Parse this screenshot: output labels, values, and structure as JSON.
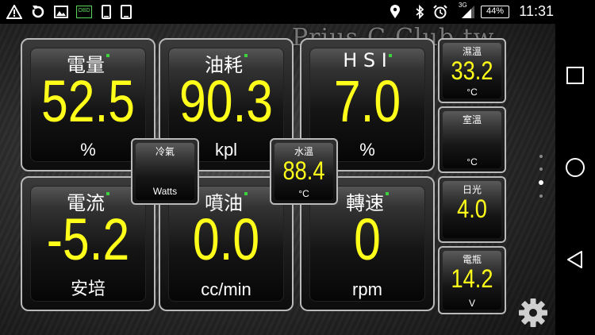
{
  "status_bar": {
    "left_icons": [
      "warning-icon",
      "sync-icon",
      "image-icon",
      "obd-icon",
      "phone-icon",
      "tablet-icon"
    ],
    "obd_label": "OBD",
    "right_icons": [
      "location-icon",
      "bluetooth-icon",
      "alarm-icon",
      "signal-icon"
    ],
    "network": "3G",
    "battery": "44%",
    "time": "11:31"
  },
  "watermark": "Prius-C-Club.tw",
  "gauges": {
    "battery_level": {
      "title": "電量",
      "value": "52.5",
      "unit": "%"
    },
    "fuel_economy": {
      "title": "油耗",
      "value": "90.3",
      "unit": "kpl"
    },
    "hsi": {
      "title": "H S I",
      "value": "7.0",
      "unit": "%"
    },
    "current": {
      "title": "電流",
      "value": "-5.2",
      "unit": "安培"
    },
    "injection": {
      "title": "噴油",
      "value": "0.0",
      "unit": "cc/min"
    },
    "rpm": {
      "title": "轉速",
      "value": "0",
      "unit": "rpm"
    }
  },
  "small_gauges": {
    "ac": {
      "title": "冷氣",
      "value": "",
      "unit": "Watts"
    },
    "water_temp": {
      "title": "水溫",
      "value": "88.4",
      "unit": "°C"
    },
    "ambient_temp": {
      "title": "濕溫",
      "value": "33.2",
      "unit": "°C"
    },
    "cabin_temp": {
      "title": "室溫",
      "value": "",
      "unit": "°C"
    },
    "sunlight": {
      "title": "日光",
      "value": "4.0",
      "unit": ""
    },
    "battery_voltage": {
      "title": "電瓶",
      "value": "14.2",
      "unit": "V"
    }
  },
  "colors": {
    "value": "#ffff1a",
    "indicator": "#3cd23c",
    "frame": "#b9b9b9"
  },
  "pager": {
    "count": 4,
    "active_index": 2
  }
}
